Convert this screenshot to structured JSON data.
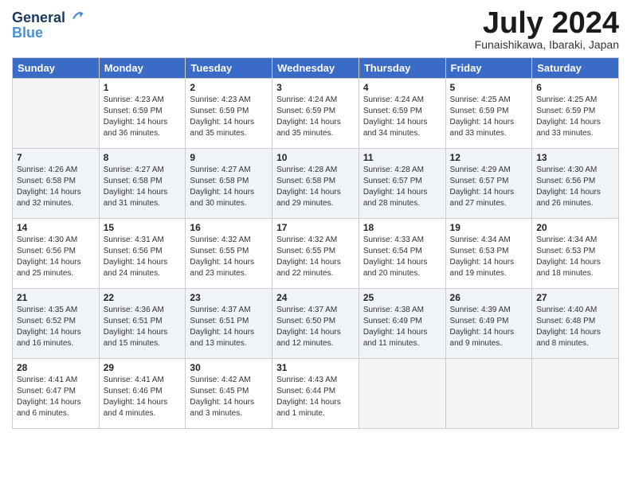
{
  "header": {
    "logo_line1": "General",
    "logo_line2": "Blue",
    "month_title": "July 2024",
    "location": "Funaishikawa, Ibaraki, Japan"
  },
  "weekdays": [
    "Sunday",
    "Monday",
    "Tuesday",
    "Wednesday",
    "Thursday",
    "Friday",
    "Saturday"
  ],
  "weeks": [
    [
      {
        "day": "",
        "empty": true
      },
      {
        "day": "1",
        "sunrise": "4:23 AM",
        "sunset": "6:59 PM",
        "daylight": "14 hours and 36 minutes."
      },
      {
        "day": "2",
        "sunrise": "4:23 AM",
        "sunset": "6:59 PM",
        "daylight": "14 hours and 35 minutes."
      },
      {
        "day": "3",
        "sunrise": "4:24 AM",
        "sunset": "6:59 PM",
        "daylight": "14 hours and 35 minutes."
      },
      {
        "day": "4",
        "sunrise": "4:24 AM",
        "sunset": "6:59 PM",
        "daylight": "14 hours and 34 minutes."
      },
      {
        "day": "5",
        "sunrise": "4:25 AM",
        "sunset": "6:59 PM",
        "daylight": "14 hours and 33 minutes."
      },
      {
        "day": "6",
        "sunrise": "4:25 AM",
        "sunset": "6:59 PM",
        "daylight": "14 hours and 33 minutes."
      }
    ],
    [
      {
        "day": "7",
        "sunrise": "4:26 AM",
        "sunset": "6:58 PM",
        "daylight": "14 hours and 32 minutes."
      },
      {
        "day": "8",
        "sunrise": "4:27 AM",
        "sunset": "6:58 PM",
        "daylight": "14 hours and 31 minutes."
      },
      {
        "day": "9",
        "sunrise": "4:27 AM",
        "sunset": "6:58 PM",
        "daylight": "14 hours and 30 minutes."
      },
      {
        "day": "10",
        "sunrise": "4:28 AM",
        "sunset": "6:58 PM",
        "daylight": "14 hours and 29 minutes."
      },
      {
        "day": "11",
        "sunrise": "4:28 AM",
        "sunset": "6:57 PM",
        "daylight": "14 hours and 28 minutes."
      },
      {
        "day": "12",
        "sunrise": "4:29 AM",
        "sunset": "6:57 PM",
        "daylight": "14 hours and 27 minutes."
      },
      {
        "day": "13",
        "sunrise": "4:30 AM",
        "sunset": "6:56 PM",
        "daylight": "14 hours and 26 minutes."
      }
    ],
    [
      {
        "day": "14",
        "sunrise": "4:30 AM",
        "sunset": "6:56 PM",
        "daylight": "14 hours and 25 minutes."
      },
      {
        "day": "15",
        "sunrise": "4:31 AM",
        "sunset": "6:56 PM",
        "daylight": "14 hours and 24 minutes."
      },
      {
        "day": "16",
        "sunrise": "4:32 AM",
        "sunset": "6:55 PM",
        "daylight": "14 hours and 23 minutes."
      },
      {
        "day": "17",
        "sunrise": "4:32 AM",
        "sunset": "6:55 PM",
        "daylight": "14 hours and 22 minutes."
      },
      {
        "day": "18",
        "sunrise": "4:33 AM",
        "sunset": "6:54 PM",
        "daylight": "14 hours and 20 minutes."
      },
      {
        "day": "19",
        "sunrise": "4:34 AM",
        "sunset": "6:53 PM",
        "daylight": "14 hours and 19 minutes."
      },
      {
        "day": "20",
        "sunrise": "4:34 AM",
        "sunset": "6:53 PM",
        "daylight": "14 hours and 18 minutes."
      }
    ],
    [
      {
        "day": "21",
        "sunrise": "4:35 AM",
        "sunset": "6:52 PM",
        "daylight": "14 hours and 16 minutes."
      },
      {
        "day": "22",
        "sunrise": "4:36 AM",
        "sunset": "6:51 PM",
        "daylight": "14 hours and 15 minutes."
      },
      {
        "day": "23",
        "sunrise": "4:37 AM",
        "sunset": "6:51 PM",
        "daylight": "14 hours and 13 minutes."
      },
      {
        "day": "24",
        "sunrise": "4:37 AM",
        "sunset": "6:50 PM",
        "daylight": "14 hours and 12 minutes."
      },
      {
        "day": "25",
        "sunrise": "4:38 AM",
        "sunset": "6:49 PM",
        "daylight": "14 hours and 11 minutes."
      },
      {
        "day": "26",
        "sunrise": "4:39 AM",
        "sunset": "6:49 PM",
        "daylight": "14 hours and 9 minutes."
      },
      {
        "day": "27",
        "sunrise": "4:40 AM",
        "sunset": "6:48 PM",
        "daylight": "14 hours and 8 minutes."
      }
    ],
    [
      {
        "day": "28",
        "sunrise": "4:41 AM",
        "sunset": "6:47 PM",
        "daylight": "14 hours and 6 minutes."
      },
      {
        "day": "29",
        "sunrise": "4:41 AM",
        "sunset": "6:46 PM",
        "daylight": "14 hours and 4 minutes."
      },
      {
        "day": "30",
        "sunrise": "4:42 AM",
        "sunset": "6:45 PM",
        "daylight": "14 hours and 3 minutes."
      },
      {
        "day": "31",
        "sunrise": "4:43 AM",
        "sunset": "6:44 PM",
        "daylight": "14 hours and 1 minute."
      },
      {
        "day": "",
        "empty": true
      },
      {
        "day": "",
        "empty": true
      },
      {
        "day": "",
        "empty": true
      }
    ]
  ]
}
